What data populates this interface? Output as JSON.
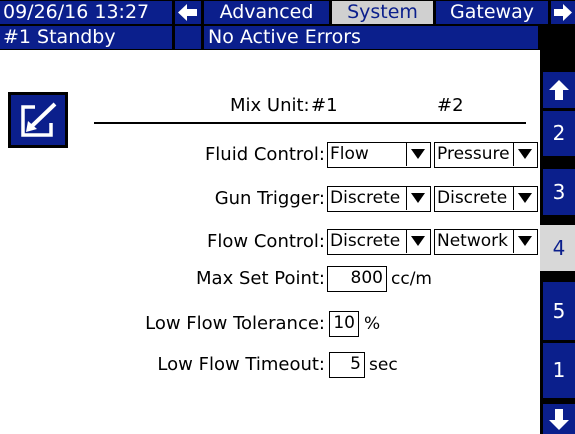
{
  "header": {
    "datetime": "09/26/16 13:27",
    "tabs": [
      {
        "label": "Advanced"
      },
      {
        "label": "System"
      },
      {
        "label": "Gateway"
      }
    ]
  },
  "status": {
    "unit": "#1 Standby",
    "errors": "No Active Errors"
  },
  "sidebar": {
    "tabs": [
      {
        "label": "2"
      },
      {
        "label": "3"
      },
      {
        "label": "4"
      },
      {
        "label": "5"
      },
      {
        "label": "1"
      }
    ]
  },
  "form": {
    "mix_unit_label": "Mix Unit:",
    "col1": "#1",
    "col2": "#2",
    "fluid_control": {
      "label": "Fluid Control:",
      "value1": "Flow",
      "value2": "Pressure"
    },
    "gun_trigger": {
      "label": "Gun Trigger:",
      "value1": "Discrete",
      "value2": "Discrete"
    },
    "flow_control": {
      "label": "Flow Control:",
      "value1": "Discrete",
      "value2": "Network"
    },
    "max_set_point": {
      "label": "Max Set Point:",
      "value": "800",
      "unit": "cc/m"
    },
    "low_flow_tolerance": {
      "label": "Low Flow Tolerance:",
      "value": "10",
      "unit": "%"
    },
    "low_flow_timeout": {
      "label": "Low Flow Timeout:",
      "value": "5",
      "unit": "sec"
    }
  }
}
